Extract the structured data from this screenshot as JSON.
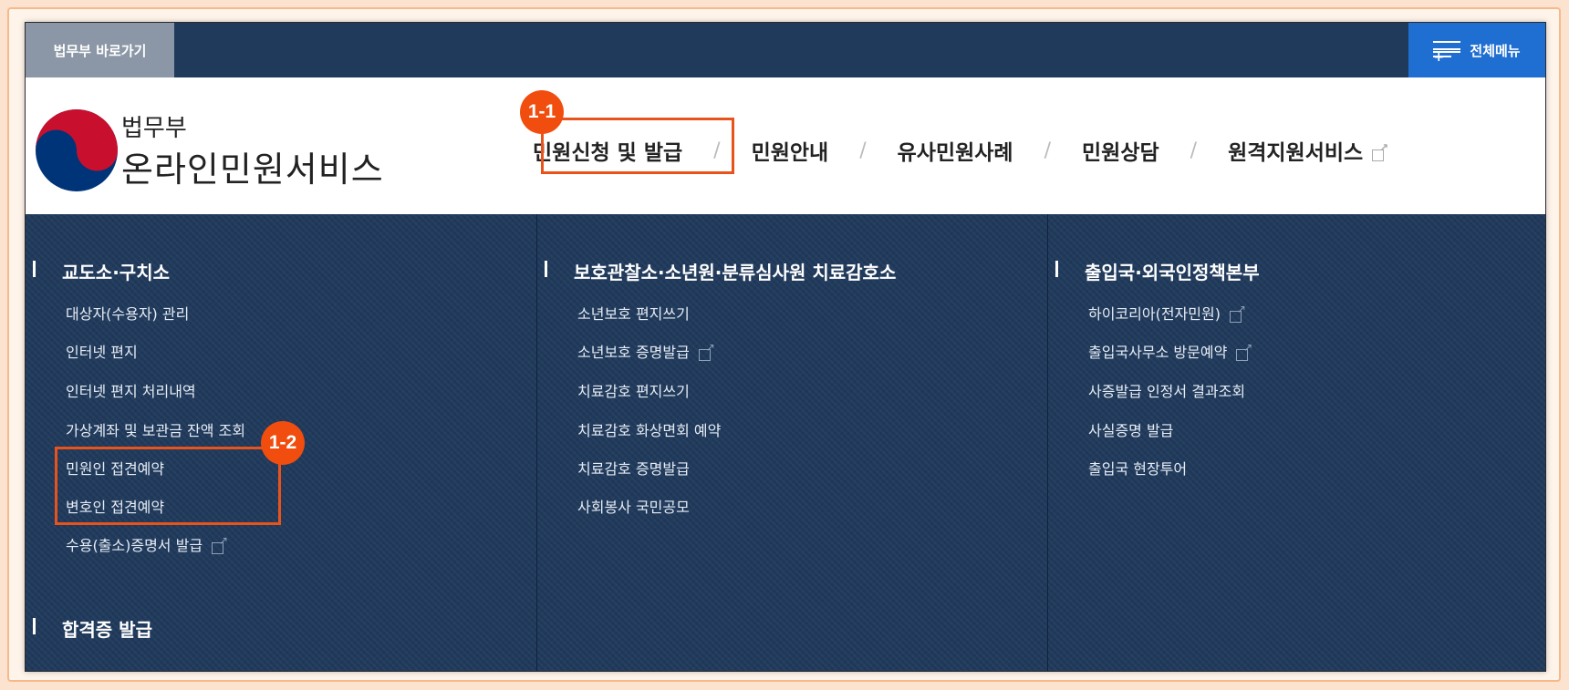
{
  "topbar": {
    "moj_link": "법무부 바로가기",
    "all_menu": "전체메뉴"
  },
  "logo": {
    "subtitle": "법무부",
    "title": "온라인민원서비스",
    "colors": {
      "red": "#c8102e",
      "blue": "#003478"
    }
  },
  "gnb": {
    "items": [
      {
        "label": "민원신청 및 발급"
      },
      {
        "label": "민원안내"
      },
      {
        "label": "유사민원사례"
      },
      {
        "label": "민원상담"
      },
      {
        "label": "원격지원서비스"
      }
    ],
    "separator": "/"
  },
  "annotations": {
    "badge1": "1-1",
    "badge2": "1-2",
    "color": "#f04d0e"
  },
  "dropdown": {
    "columns": [
      {
        "heading": "교도소·구치소",
        "links": [
          "대상자(수용자) 관리",
          "인터넷 편지",
          "인터넷 편지 처리내역",
          "가상계좌 및 보관금 잔액 조회",
          "민원인 접견예약",
          "변호인 접견예약",
          "수용(출소)증명서 발급"
        ],
        "heading2": "합격증 발급"
      },
      {
        "heading": "보호관찰소·소년원·분류심사원 치료감호소",
        "links": [
          "소년보호 편지쓰기",
          "소년보호 증명발급",
          "치료감호 편지쓰기",
          "치료감호 화상면회 예약",
          "치료감호 증명발급",
          "사회봉사 국민공모"
        ]
      },
      {
        "heading": "출입국·외국인정책본부",
        "links": [
          "하이코리아(전자민원)",
          "출입국사무소 방문예약",
          "사증발급 인정서 결과조회",
          "사실증명 발급",
          "출입국 현장투어"
        ]
      }
    ]
  },
  "colors": {
    "navy": "#203a5c",
    "gray_button": "#8b97a6",
    "blue_button": "#1f6ed1",
    "highlight": "#e8531c"
  }
}
